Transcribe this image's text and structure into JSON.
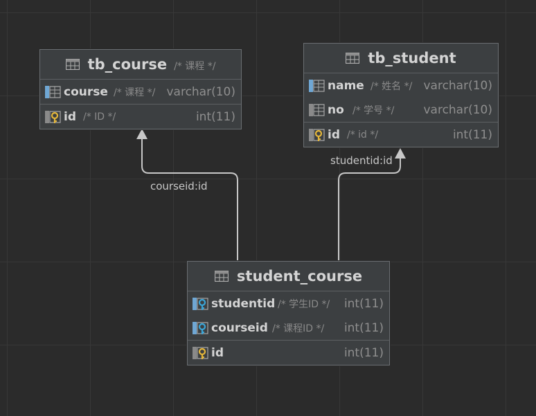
{
  "colors": {
    "background": "#2b2b2b",
    "grid": "#383838",
    "table_bg": "#3c3f41",
    "table_border": "#6a6e72",
    "key_gold": "#e5b73a",
    "fk_blue": "#3aa6d8",
    "column_blue": "#6fa7d4",
    "edge": "#c8c8c8"
  },
  "tables": {
    "tb_course": {
      "name": "tb_course",
      "comment": "/* 课程 */",
      "columns": [
        {
          "name": "course",
          "comment": "/* 课程 */",
          "type": "varchar(10)",
          "icon": "column-icon"
        }
      ],
      "keys": [
        {
          "name": "id",
          "comment": "/* ID */",
          "type": "int(11)",
          "icon": "primary-key-icon"
        }
      ]
    },
    "tb_student": {
      "name": "tb_student",
      "comment": "",
      "columns": [
        {
          "name": "name",
          "comment": "/* 姓名 */",
          "type": "varchar(10)",
          "icon": "column-icon"
        },
        {
          "name": "no",
          "comment": "/* 学号 */",
          "type": "varchar(10)",
          "icon": "column-icon"
        }
      ],
      "keys": [
        {
          "name": "id",
          "comment": "/* id */",
          "type": "int(11)",
          "icon": "primary-key-icon"
        }
      ]
    },
    "student_course": {
      "name": "student_course",
      "comment": "",
      "columns": [
        {
          "name": "studentid",
          "comment": "/* 学生ID */",
          "type": "int(11)",
          "icon": "foreign-key-icon"
        },
        {
          "name": "courseid",
          "comment": "/* 课程ID */",
          "type": "int(11)",
          "icon": "foreign-key-icon"
        }
      ],
      "keys": [
        {
          "name": "id",
          "comment": "",
          "type": "int(11)",
          "icon": "primary-key-icon"
        }
      ]
    }
  },
  "relations": [
    {
      "label": "courseid:id",
      "from": "student_course",
      "to": "tb_course"
    },
    {
      "label": "studentid:id",
      "from": "student_course",
      "to": "tb_student"
    }
  ]
}
